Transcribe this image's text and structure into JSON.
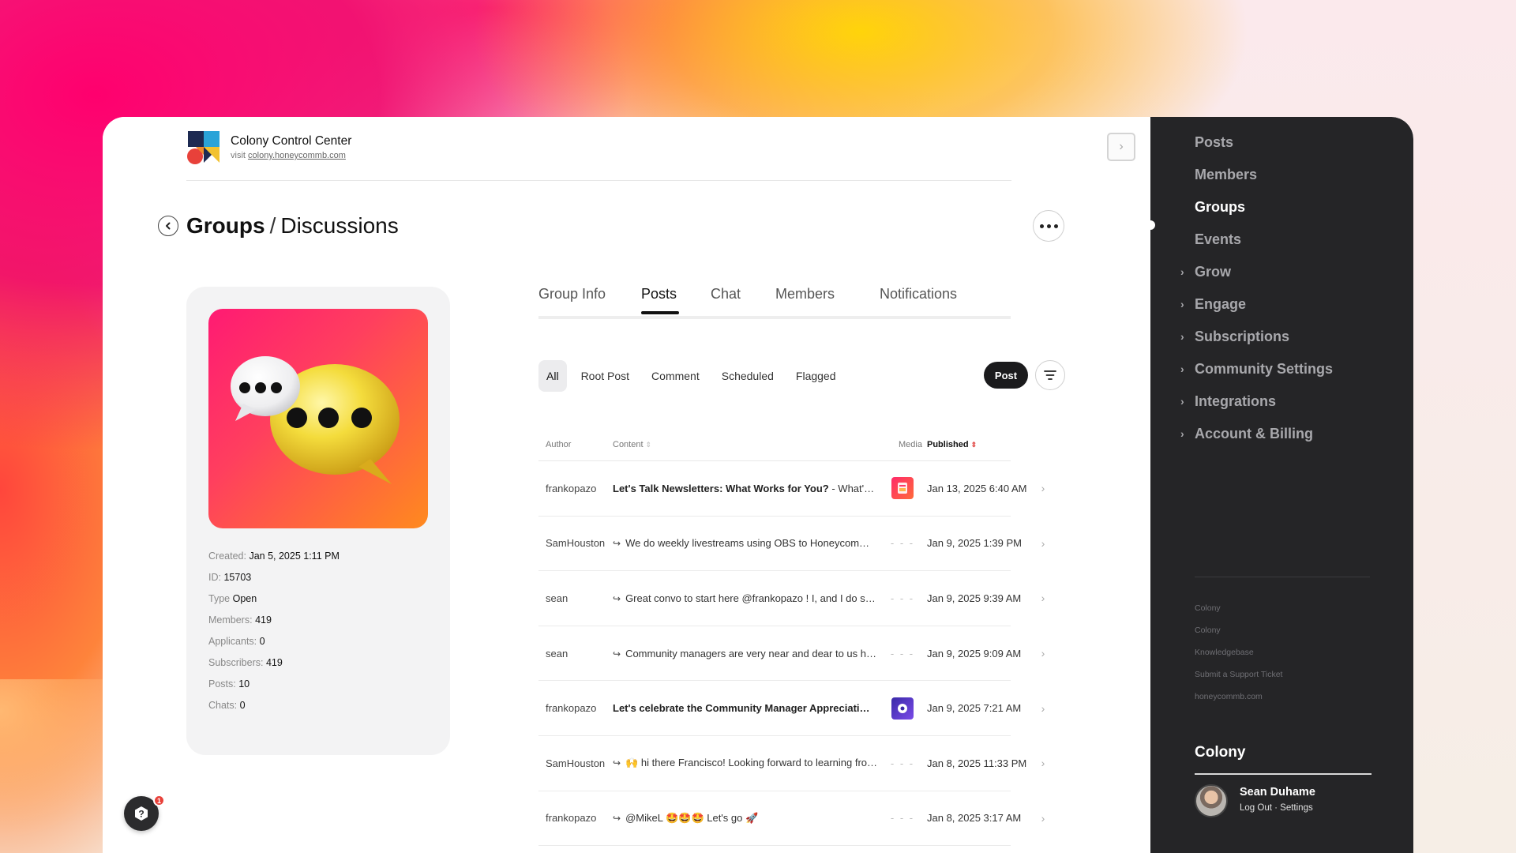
{
  "header": {
    "title": "Colony Control Center",
    "visit_prefix": "visit",
    "visit_link": "colony.honeycommb.com"
  },
  "breadcrumb": {
    "parent": "Groups",
    "separator": "/",
    "current": "Discussions"
  },
  "group": {
    "meta": [
      {
        "key": "Created:",
        "value": "Jan 5, 2025 1:11 PM"
      },
      {
        "key": "ID:",
        "value": "15703"
      },
      {
        "key": "Type",
        "value": "Open"
      },
      {
        "key": "Members:",
        "value": "419"
      },
      {
        "key": "Applicants:",
        "value": "0"
      },
      {
        "key": "Subscribers:",
        "value": "419"
      },
      {
        "key": "Posts:",
        "value": "10"
      },
      {
        "key": "Chats:",
        "value": "0"
      }
    ]
  },
  "tabs": [
    {
      "label": "Group Info",
      "active": false
    },
    {
      "label": "Posts",
      "active": true
    },
    {
      "label": "Chat",
      "active": false
    },
    {
      "label": "Members",
      "active": false
    },
    {
      "label": "Notifications",
      "active": false
    }
  ],
  "filters": [
    {
      "label": "All",
      "active": true
    },
    {
      "label": "Root Post",
      "active": false
    },
    {
      "label": "Comment",
      "active": false
    },
    {
      "label": "Scheduled",
      "active": false
    },
    {
      "label": "Flagged",
      "active": false
    }
  ],
  "post_button": "Post",
  "table": {
    "columns": {
      "author": "Author",
      "content": "Content",
      "media": "Media",
      "published": "Published"
    },
    "rows": [
      {
        "author": "frankopazo",
        "is_reply": false,
        "title": "Let's Talk Newsletters: What Works for You?",
        "content": " - What'…",
        "media": "image",
        "media_color": "pink",
        "published": "Jan 13, 2025 6:40 AM"
      },
      {
        "author": "SamHouston",
        "is_reply": true,
        "title": "",
        "content": "We do weekly livestreams using OBS to Honeycom…",
        "media": "- - -",
        "published": "Jan 9, 2025 1:39 PM"
      },
      {
        "author": "sean",
        "is_reply": true,
        "title": "",
        "content": "Great convo to start here @frankopazo ! I, and I do s…",
        "media": "- - -",
        "published": "Jan 9, 2025 9:39 AM"
      },
      {
        "author": "sean",
        "is_reply": true,
        "title": "",
        "content": "Community managers are very near and dear to us h…",
        "media": "- - -",
        "published": "Jan 9, 2025 9:09 AM"
      },
      {
        "author": "frankopazo",
        "is_reply": false,
        "title": "Let's celebrate the Community Manager Appreciati…",
        "content": "",
        "media": "image",
        "media_color": "purple",
        "published": "Jan 9, 2025 7:21 AM"
      },
      {
        "author": "SamHouston",
        "is_reply": true,
        "title": "",
        "content": "🙌 hi there Francisco! Looking forward to learning fro…",
        "media": "- - -",
        "published": "Jan 8, 2025 11:33 PM"
      },
      {
        "author": "frankopazo",
        "is_reply": true,
        "title": "",
        "content": "@MikeL 🤩🤩🤩 Let's go 🚀",
        "media": "- - -",
        "published": "Jan 8, 2025 3:17 AM"
      }
    ]
  },
  "sidebar": {
    "items": [
      {
        "label": "Posts",
        "expandable": false,
        "active": false
      },
      {
        "label": "Members",
        "expandable": false,
        "active": false
      },
      {
        "label": "Groups",
        "expandable": false,
        "active": true
      },
      {
        "label": "Events",
        "expandable": false,
        "active": false
      },
      {
        "label": "Grow",
        "expandable": true,
        "active": false
      },
      {
        "label": "Engage",
        "expandable": true,
        "active": false
      },
      {
        "label": "Subscriptions",
        "expandable": true,
        "active": false
      },
      {
        "label": "Community Settings",
        "expandable": true,
        "active": false
      },
      {
        "label": "Integrations",
        "expandable": true,
        "active": false
      },
      {
        "label": "Account & Billing",
        "expandable": true,
        "active": false
      }
    ],
    "links": [
      "Colony",
      "Colony",
      "Knowledgebase",
      "Submit a Support Ticket",
      "honeycommb.com"
    ],
    "org_name": "Colony",
    "user": {
      "name": "Sean Duhame",
      "log_out": "Log Out",
      "separator": "·",
      "settings": "Settings"
    }
  },
  "help": {
    "badge_count": "1"
  },
  "colors": {
    "sidebar_bg": "#252527",
    "accent_dark": "#1b1b1d",
    "badge_red": "#e8413a"
  }
}
